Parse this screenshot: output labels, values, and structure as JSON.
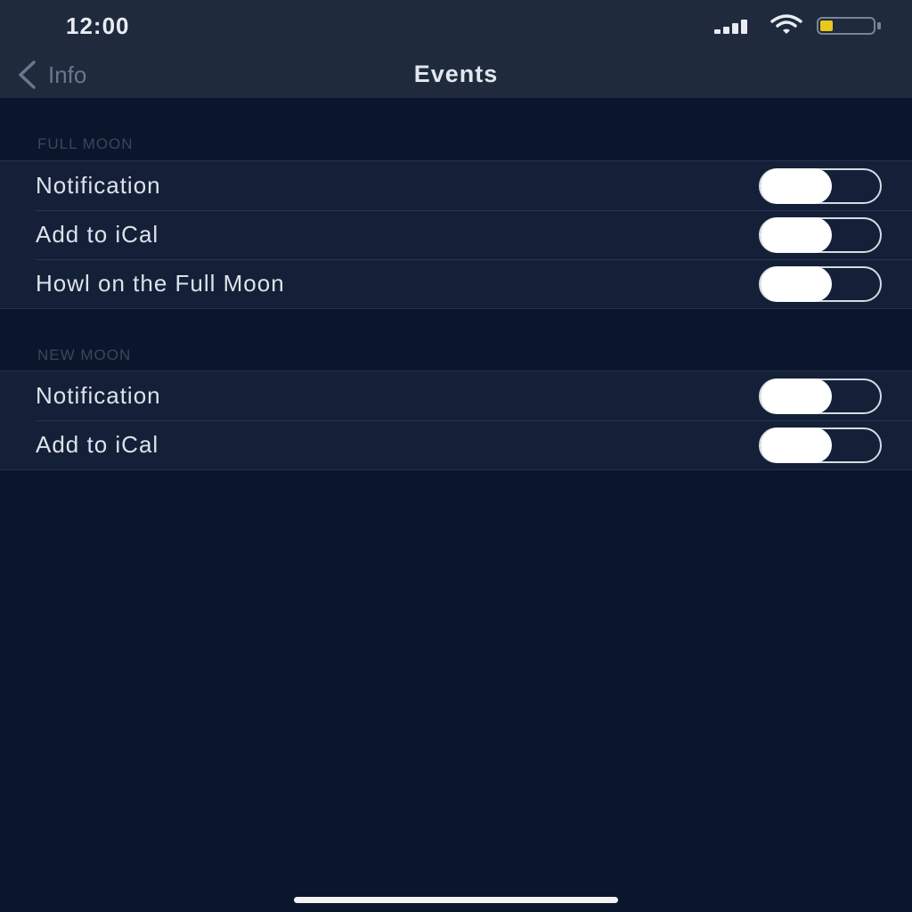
{
  "status_bar": {
    "time": "12:00",
    "icons": [
      "signal-icon",
      "wifi-icon",
      "battery-icon"
    ],
    "battery_color": "#e9c81c"
  },
  "nav": {
    "back_label": "Info",
    "title": "Events"
  },
  "sections": [
    {
      "header": "FULL MOON",
      "rows": [
        {
          "label": "Notification",
          "on": false
        },
        {
          "label": "Add to iCal",
          "on": false
        },
        {
          "label": "Howl on the Full Moon",
          "on": false
        }
      ]
    },
    {
      "header": "NEW MOON",
      "rows": [
        {
          "label": "Notification",
          "on": false
        },
        {
          "label": "Add to iCal",
          "on": false
        }
      ]
    }
  ],
  "colors": {
    "background": "#0b152b",
    "header": "#1f2a3d",
    "cell": "#142038"
  }
}
